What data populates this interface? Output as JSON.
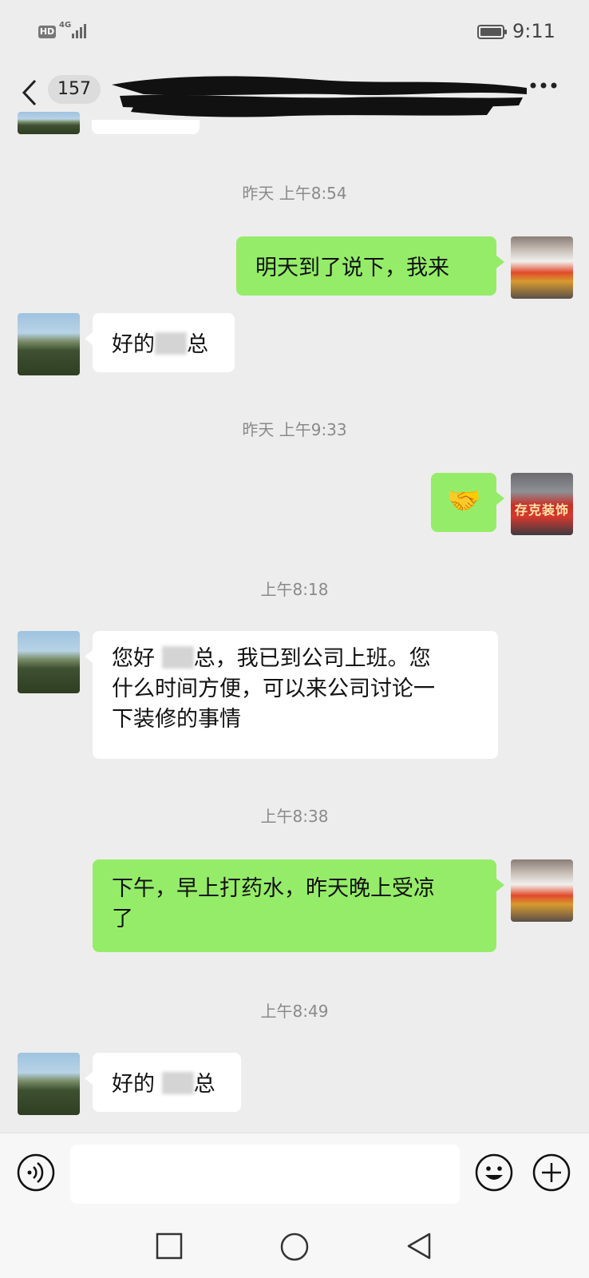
{
  "status_bar": {
    "hd": "HD",
    "network": "4G",
    "time": "9:11",
    "battery_level": 0.95
  },
  "header": {
    "unread_count": "157",
    "contact_name_redacted": true,
    "icons": {
      "back": "chevron-left-icon",
      "more": "more-icon"
    }
  },
  "messages": [
    {
      "type": "time",
      "text": "昨天 上午8:54"
    },
    {
      "type": "msg",
      "from": "self",
      "text": "明天到了说下，我来"
    },
    {
      "type": "msg",
      "from": "other",
      "text_before": "好的",
      "redacted": true,
      "text_after": "总"
    },
    {
      "type": "time",
      "text": "昨天 上午9:33"
    },
    {
      "type": "msg",
      "from": "self",
      "emoji": "handshake",
      "glyph": "🤝",
      "avatar_caption": "存克装饰"
    },
    {
      "type": "time",
      "text": "上午8:18"
    },
    {
      "type": "msg",
      "from": "other",
      "lines": [
        "您好",
        "总，我已到公司上班。您",
        "什么时间方便，可以来公司讨论一",
        "下装修的事情"
      ]
    },
    {
      "type": "time",
      "text": "上午8:38"
    },
    {
      "type": "msg",
      "from": "self",
      "lines": [
        "下午，早上打药水，昨天晚上受凉",
        "了"
      ]
    },
    {
      "type": "time",
      "text": "上午8:49"
    },
    {
      "type": "msg",
      "from": "other",
      "text_before": "好的",
      "redacted": true,
      "text_after": "总"
    }
  ],
  "composer": {
    "icons": {
      "voice": "voice-icon",
      "emoji": "emoji-icon",
      "plus": "plus-icon"
    }
  },
  "navigation": {
    "icons": {
      "recents": "recents-square-icon",
      "home": "home-circle-icon",
      "back": "back-triangle-icon"
    }
  },
  "colors": {
    "background": "#ededed",
    "bubble_self": "#95ec69",
    "bubble_other": "#ffffff",
    "timestamp": "#8a8a8a"
  }
}
